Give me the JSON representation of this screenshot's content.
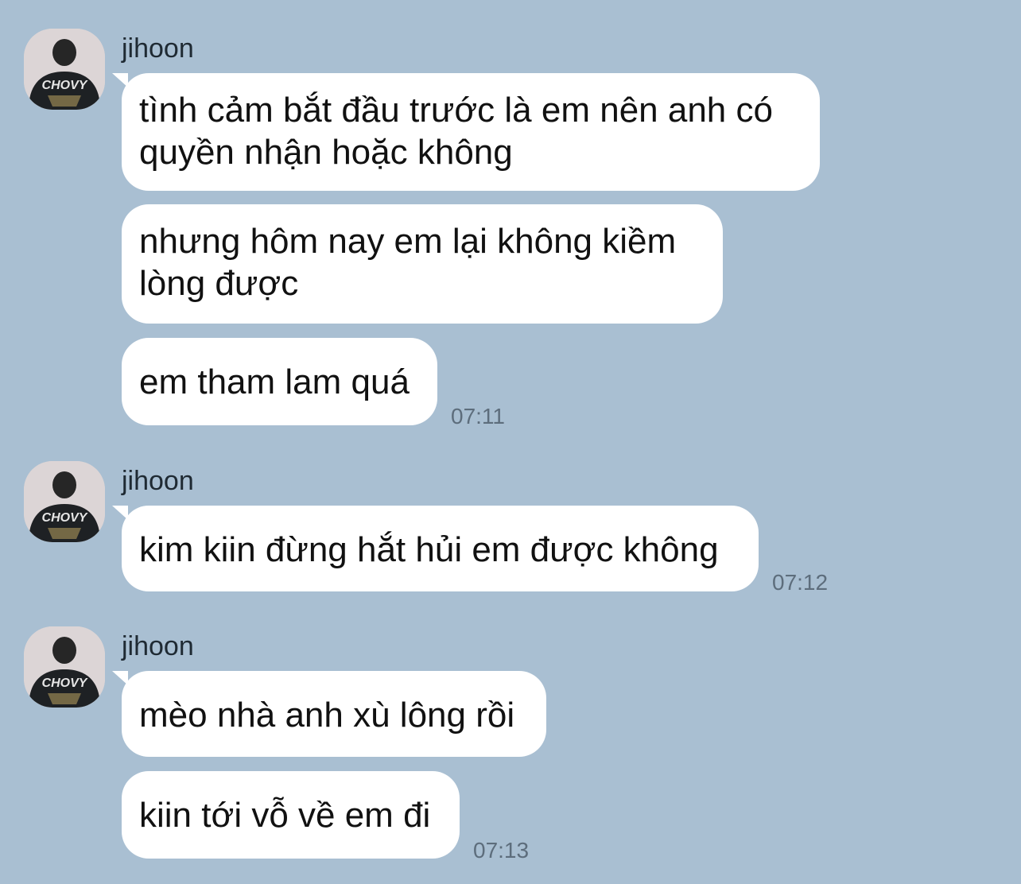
{
  "groups": [
    {
      "sender": "jihoon",
      "time": "07:11",
      "messages": [
        {
          "line1": "tình cảm bắt đầu trước là em nên anh có",
          "line2": "quyền nhận hoặc không"
        },
        {
          "line1": "nhưng hôm nay em lại không kiềm",
          "line2": "lòng được"
        },
        {
          "line1": "em tham lam quá"
        }
      ]
    },
    {
      "sender": "jihoon",
      "time": "07:12",
      "messages": [
        {
          "line1": "kim kiin đừng hắt hủi em được không"
        }
      ]
    },
    {
      "sender": "jihoon",
      "time": "07:13",
      "messages": [
        {
          "line1": "mèo nhà anh xù lông rồi"
        },
        {
          "line1": "kiin tới vỗ về em đi"
        }
      ]
    }
  ],
  "avatar": {
    "icon": "avatar-photo-icon",
    "shirt_text": "CHOVY"
  },
  "colors": {
    "background": "#a9bfd2",
    "bubble": "#ffffff",
    "timestamp": "#5d6d7c"
  }
}
